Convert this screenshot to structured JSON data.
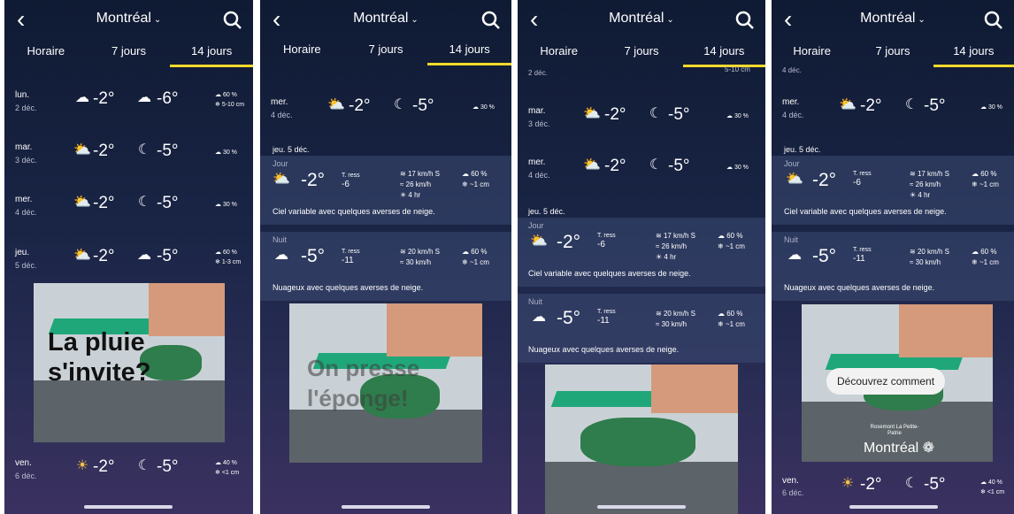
{
  "header": {
    "city": "Montréal"
  },
  "tabs": [
    "Horaire",
    "7 jours",
    "14 jours"
  ],
  "colors": {
    "accent": "#f2d92b"
  },
  "days": {
    "lun": {
      "day": "lun.",
      "date": "2 déc.",
      "high": "-2°",
      "low": "-6°",
      "pop": "60 %",
      "amt": "5-10 cm"
    },
    "mar": {
      "day": "mar.",
      "date": "3 déc.",
      "high": "-2°",
      "low": "-5°",
      "pop": "30 %"
    },
    "mer": {
      "day": "mer.",
      "date": "4 déc.",
      "high": "-2°",
      "low": "-5°",
      "pop": "30 %"
    },
    "jeu": {
      "day": "jeu.",
      "date": "5 déc.",
      "high": "-2°",
      "low": "-5°",
      "pop": "60 %",
      "amt": "1-3 cm"
    },
    "ven": {
      "day": "ven.",
      "date": "6 déc.",
      "high": "-2°",
      "low": "-5°",
      "pop": "40 %",
      "amt": "<1 cm"
    }
  },
  "detail": {
    "heading": "jeu. 5 déc.",
    "jour": {
      "label": "Jour",
      "temp": "-2°",
      "ress_label": "T. ress",
      "ress": "-6",
      "wind": "17 km/h S",
      "gust": "26 km/h",
      "sun": "4 hr",
      "pop": "60 %",
      "amt": "~1 cm",
      "desc": "Ciel variable avec quelques averses de neige."
    },
    "nuit": {
      "label": "Nuit",
      "temp": "-5°",
      "ress_label": "T. ress",
      "ress": "-11",
      "wind": "20 km/h S",
      "gust": "30 km/h",
      "pop": "60 %",
      "amt": "~1 cm",
      "desc": "Nuageux avec quelques averses de neige."
    }
  },
  "ads": {
    "a1": "La pluie s'invite?",
    "a2": "On presse l'éponge!",
    "a4_button": "Découvrez comment",
    "a4_sub": "Rosemont La Petite-Patrie",
    "a4_logo": "Montréal"
  },
  "cut": {
    "p3": "2 déc.",
    "p4": "4 déc.",
    "p3_amt": "5-10 cm"
  },
  "icons": [
    "back-icon",
    "search-icon",
    "snow-cloud-icon",
    "sun-cloud-icon",
    "moon-icon",
    "moon-cloud-icon",
    "sun-icon",
    "precip-icon",
    "snowflake-icon",
    "wind-icon",
    "gust-icon"
  ]
}
